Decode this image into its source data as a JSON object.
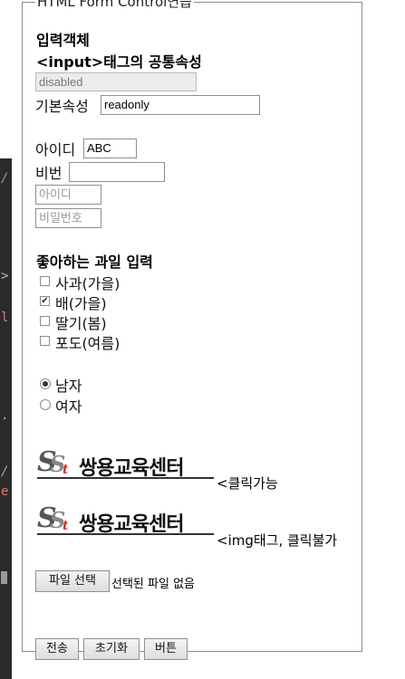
{
  "legend": "HTML Form Control연습",
  "section1": {
    "heading": "입력객체",
    "subheading": "<input>태그의 공통속성",
    "disabled_value": "disabled",
    "basic_attr_label": "기본속성",
    "readonly_value": "readonly"
  },
  "login": {
    "id_label": "아이디",
    "id_value": "ABC",
    "pw_label": "비번",
    "id_placeholder": "아이디",
    "pw_placeholder": "비밀번호"
  },
  "fruits": {
    "heading": "좋아하는 과일 입력",
    "items": [
      {
        "label": "사과(가을)",
        "checked": false
      },
      {
        "label": "배(가을)",
        "checked": true
      },
      {
        "label": "딸기(봄)",
        "checked": false
      },
      {
        "label": "포도(여름)",
        "checked": false
      }
    ]
  },
  "gender": {
    "options": [
      {
        "label": "남자",
        "selected": true
      },
      {
        "label": "여자",
        "selected": false
      }
    ]
  },
  "images": {
    "logo_text": "쌍용교육센터",
    "logo_mark": "SSt",
    "clickable_caption": "<클릭가능",
    "img_caption": "<img태그, 클릭불가"
  },
  "file": {
    "button_label": "파일 선택",
    "status": "선택된 파일 없음"
  },
  "actions": {
    "submit": "전송",
    "reset": "초기화",
    "button": "버튼"
  },
  "colors": {
    "logo_accent": "#dd2222",
    "editor_bg": "#2b2b2b"
  }
}
